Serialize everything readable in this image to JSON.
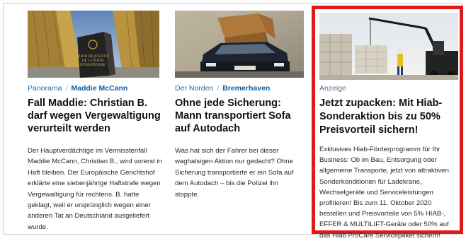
{
  "articles": [
    {
      "image_alt": "Gebäude des Europäischen Gerichtshofs",
      "image_text": "COUR DE JUSTICE DE L'UNION EUROPÉENNE",
      "category": "Panorama",
      "department": "Maddie McCann",
      "headline": "Fall Maddie: Christian B. darf wegen Vergewaltigung verurteilt werden",
      "teaser": "Der Hauptverdächtige im Vermisstenfall Maddie McCann, Christian B., wird vorerst in Haft bleiben. Der Europäische Gerichtshof erklärte eine siebenjährige Haftstrafe wegen Vergewaltigung für rechtens. B. hatte geklagt, weil er ursprünglich wegen einer anderen Tat an Deutschland ausgeliefert wurde."
    },
    {
      "image_alt": "Auto mit Sofa auf dem Dach",
      "category": "Der Norden",
      "department": "Bremerhaven",
      "headline": "Ohne jede Sicherung: Mann transportiert Sofa auf Autodach",
      "teaser": "Was hat sich der Fahrer bei dieser waghalsigen Aktion nur gedacht? Ohne Sicherung transportierte er ein Sofa auf dem Autodach – bis die Polizei ihn stoppte."
    },
    {
      "image_alt": "Ladekran auf einer Baustelle",
      "category": "Anzeige",
      "headline": "Jetzt zupacken: Mit Hiab-Sonderaktion bis zu 50% Preisvorteil sichern!",
      "teaser": "Exklusives Hiab-Förderprogramm für Ihr Business: Ob im Bau, Entsorgung oder allgemeine Transporte, jetzt von attraktiven Sonderkonditionen für Ladekrane, Wechselgeräte und Serviceleistungen profitieren! Bis zum 11. Oktober 2020 bestellen und Preisvorteile von 5% HIAB-, EFFER & MULTILIFT-Geräte oder 50% auf das Hiab ProCare Servicepaket sichern!"
    }
  ],
  "separator": "/",
  "colors": {
    "link_blue": "#1e6aa8",
    "ad_border": "#e01a1a",
    "headline": "#111111"
  }
}
